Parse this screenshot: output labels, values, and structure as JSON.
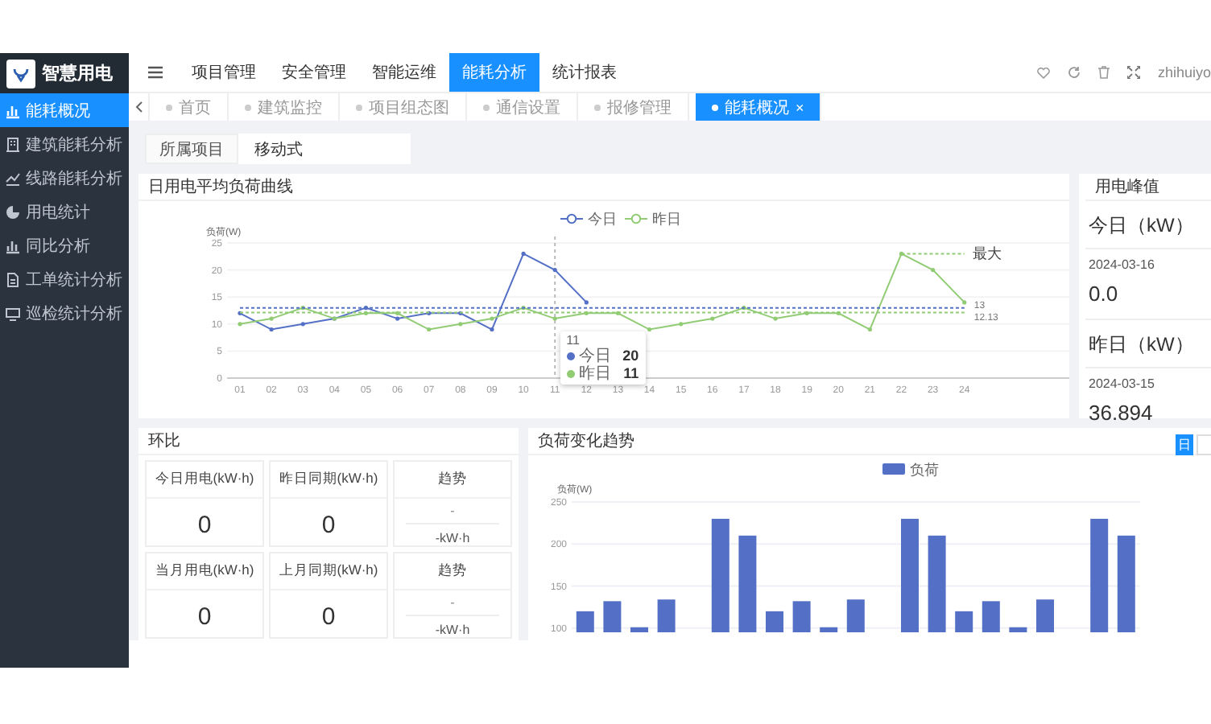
{
  "sidebar": {
    "logo_text": "智慧用电",
    "items": [
      {
        "label": "能耗概况",
        "selected": true
      },
      {
        "label": "建筑能耗分析",
        "selected": false
      },
      {
        "label": "线路能耗分析",
        "selected": false
      },
      {
        "label": "用电统计",
        "selected": false
      },
      {
        "label": "同比分析",
        "selected": false
      },
      {
        "label": "工单统计分析",
        "selected": false
      },
      {
        "label": "巡检统计分析",
        "selected": false
      }
    ]
  },
  "header": {
    "nav": [
      {
        "label": "项目管理",
        "selected": false
      },
      {
        "label": "安全管理",
        "selected": false
      },
      {
        "label": "智能运维",
        "selected": false
      },
      {
        "label": "能耗分析",
        "selected": true
      },
      {
        "label": "统计报表",
        "selected": false
      }
    ],
    "user": "zhihuiyo"
  },
  "tabs": [
    {
      "label": "首页",
      "selected": false
    },
    {
      "label": "建筑监控",
      "selected": false
    },
    {
      "label": "项目组态图",
      "selected": false
    },
    {
      "label": "通信设置",
      "selected": false
    },
    {
      "label": "报修管理",
      "selected": false
    },
    {
      "label": "能耗概况",
      "selected": true,
      "close": "×"
    }
  ],
  "filter": {
    "label": "所属项目",
    "value": "移动式"
  },
  "load_curve": {
    "title": "日用电平均负荷曲线",
    "chart_data": {
      "type": "line",
      "ylabel": "负荷(W)",
      "categories": [
        "01",
        "02",
        "03",
        "04",
        "05",
        "06",
        "07",
        "08",
        "09",
        "10",
        "11",
        "12",
        "13",
        "14",
        "15",
        "16",
        "17",
        "18",
        "19",
        "20",
        "21",
        "22",
        "23",
        "24"
      ],
      "ylim": [
        0,
        25
      ],
      "yticks": [
        0,
        5,
        10,
        15,
        20,
        25
      ],
      "grid": true,
      "legend": "top",
      "series": [
        {
          "name": "今日",
          "color": "#5470c6",
          "values": [
            12,
            9,
            10,
            11,
            13,
            11,
            12,
            12,
            9,
            23,
            20,
            14,
            null,
            null,
            null,
            null,
            null,
            null,
            null,
            null,
            null,
            null,
            null,
            null
          ]
        },
        {
          "name": "昨日",
          "color": "#91cc75",
          "values": [
            10,
            11,
            13,
            11,
            12,
            12,
            9,
            10,
            11,
            13,
            11,
            12,
            12,
            9,
            10,
            11,
            13,
            11,
            12,
            12,
            9,
            23,
            20,
            14
          ]
        }
      ],
      "ref_lines": [
        {
          "axis": "y",
          "value": 13,
          "label": "13",
          "color": "#5470c6"
        },
        {
          "axis": "y",
          "value": 12.13,
          "label": "12.13",
          "color": "#91cc75"
        },
        {
          "axis": "x",
          "value": "11",
          "color": "#bbbbbb"
        }
      ],
      "annotations": [
        "最大"
      ]
    },
    "tooltip": {
      "title": "11",
      "rows": [
        {
          "name": "今日",
          "value": "20",
          "color": "#5470c6"
        },
        {
          "name": "昨日",
          "value": "11",
          "color": "#91cc75"
        }
      ]
    }
  },
  "peak": {
    "title": "用电峰值",
    "blocks": [
      {
        "label": "今日（kW）",
        "date": "2024-03-16",
        "value": "0.0"
      },
      {
        "label": "昨日（kW）",
        "date": "2024-03-15",
        "value": "36.894"
      }
    ]
  },
  "comparison": {
    "title": "环比",
    "rows": [
      [
        {
          "kind": "value",
          "label": "今日用电(kW·h)",
          "value": "0"
        },
        {
          "kind": "value",
          "label": "昨日同期(kW·h)",
          "value": "0"
        },
        {
          "kind": "trend",
          "label": "趋势",
          "value": "-",
          "unit": "-kW·h"
        }
      ],
      [
        {
          "kind": "value",
          "label": "当月用电(kW·h)",
          "value": "0"
        },
        {
          "kind": "value",
          "label": "上月同期(kW·h)",
          "value": "0"
        },
        {
          "kind": "trend",
          "label": "趋势",
          "value": "-",
          "unit": "-kW·h"
        }
      ]
    ]
  },
  "trend": {
    "title": "负荷变化趋势",
    "buttons": [
      {
        "label": "日",
        "selected": true
      },
      {
        "selected": false
      }
    ],
    "chart_data": {
      "type": "bar",
      "ylabel": "负荷(W)",
      "ylim": [
        95,
        250
      ],
      "yticks": [
        100,
        150,
        200,
        250
      ],
      "grid": true,
      "legend": "top",
      "series": [
        {
          "name": "负荷",
          "color": "#5470c6",
          "values": [
            120,
            132,
            101,
            134,
            null,
            230,
            210,
            120,
            132,
            101,
            134,
            null,
            230,
            210,
            120,
            132,
            101,
            134,
            null,
            230,
            210
          ]
        }
      ]
    }
  }
}
